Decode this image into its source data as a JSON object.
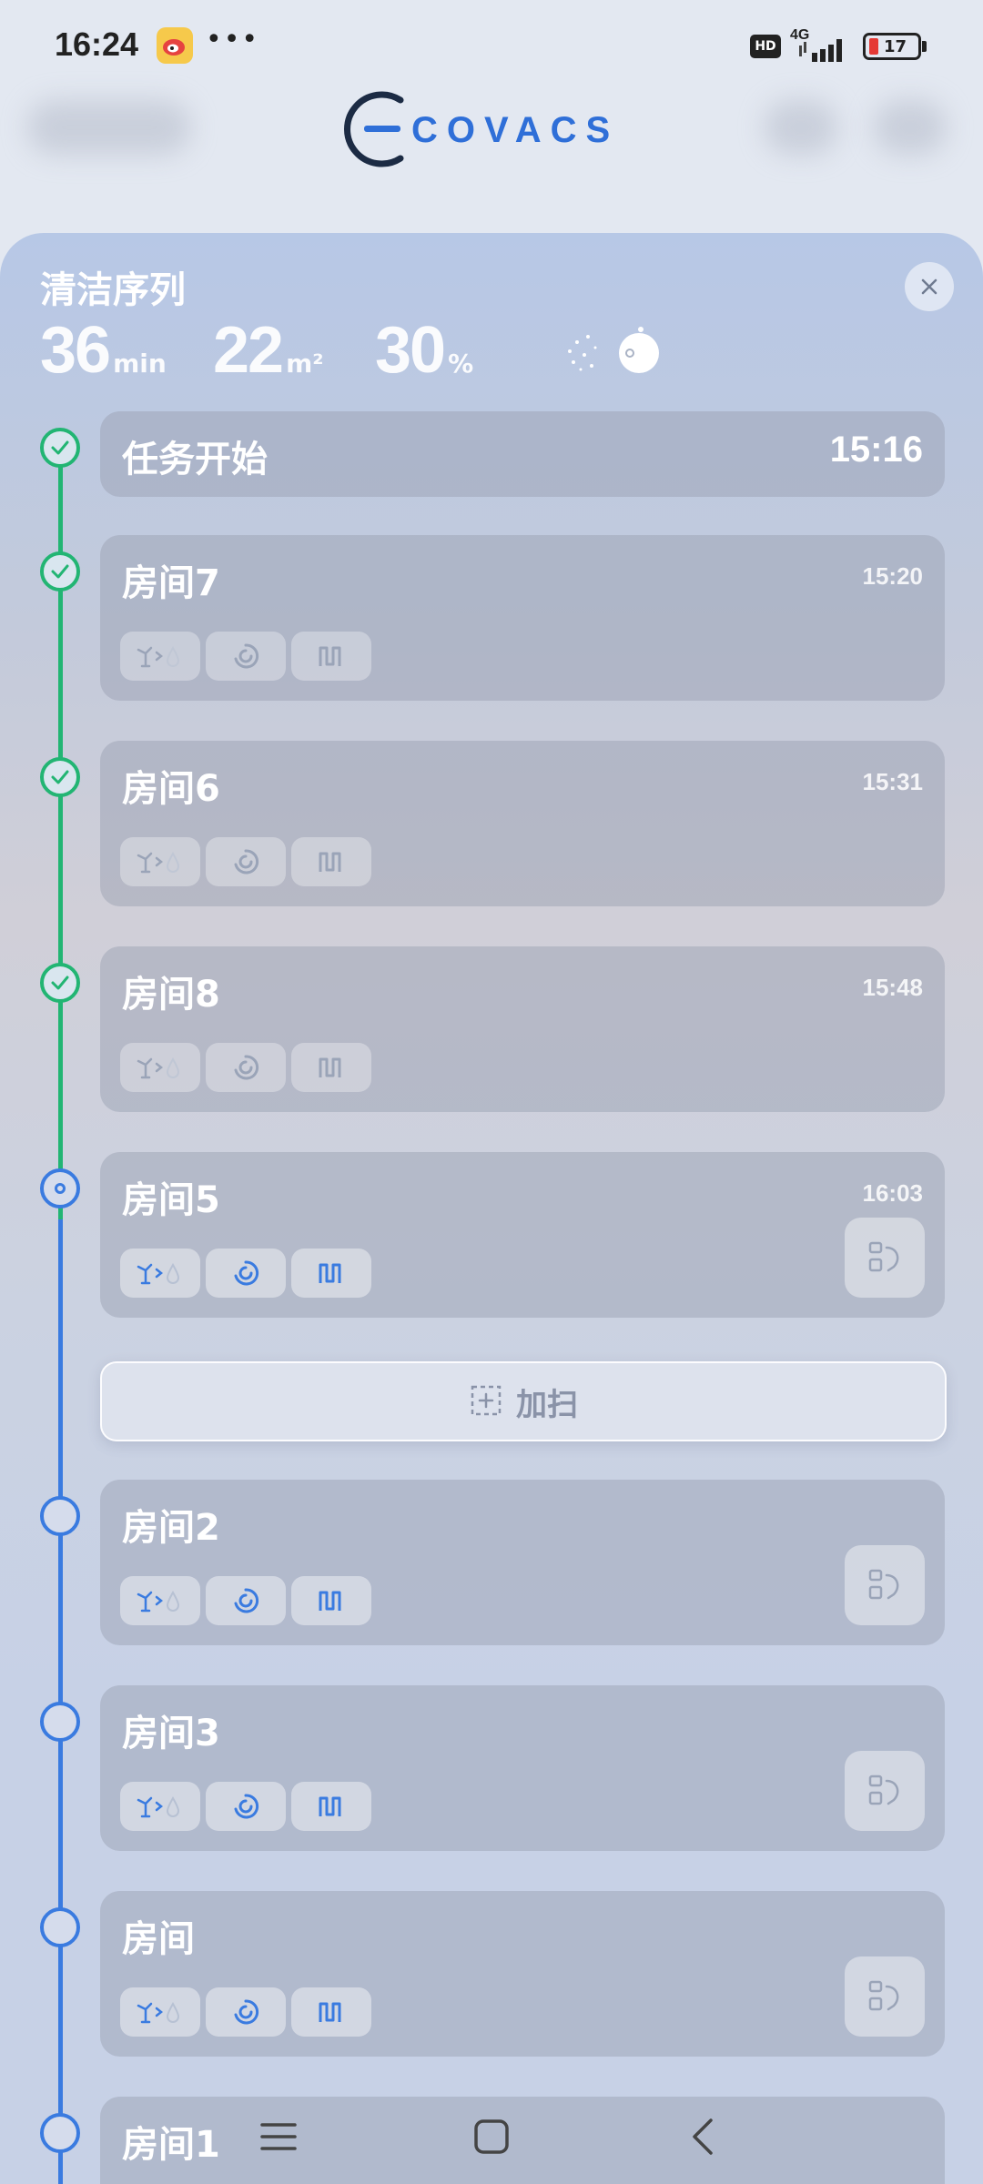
{
  "status_bar": {
    "time": "16:24",
    "dots": "•••",
    "hd": "HD",
    "network": "4G",
    "battery": "17"
  },
  "header": {
    "logo_text": "ECOVACS"
  },
  "sheet": {
    "title": "清洁序列",
    "stats": [
      {
        "value": "36",
        "unit": "min"
      },
      {
        "value": "22",
        "unit": "m²"
      },
      {
        "value": "30",
        "unit": "%"
      }
    ]
  },
  "tasks": [
    {
      "title": "任务开始",
      "time": "15:16",
      "status": "done"
    },
    {
      "title": "房间7",
      "time": "15:20",
      "status": "done"
    },
    {
      "title": "房间6",
      "time": "15:31",
      "status": "done"
    },
    {
      "title": "房间8",
      "time": "15:48",
      "status": "done"
    },
    {
      "title": "房间5",
      "time": "16:03",
      "status": "current"
    },
    {
      "title": "房间2",
      "time": "",
      "status": "pending"
    },
    {
      "title": "房间3",
      "time": "",
      "status": "pending"
    },
    {
      "title": "房间",
      "time": "",
      "status": "pending"
    },
    {
      "title": "房间1",
      "time": "",
      "status": "pending"
    }
  ],
  "add_clean": {
    "label": "加扫"
  },
  "colors": {
    "done": "#22b573",
    "active": "#3a7be0",
    "chip_icon_muted": "#9aa4b8",
    "chip_icon_active": "#3a7be0"
  },
  "icons": {
    "chip_1": "mop-water-icon",
    "chip_2": "suction-icon",
    "chip_3": "path-pattern-icon",
    "edit": "edit-area-icon"
  }
}
